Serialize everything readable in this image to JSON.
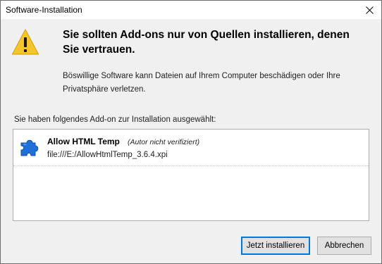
{
  "window": {
    "title": "Software-Installation",
    "close_icon": "close-icon"
  },
  "warning": {
    "icon": "warning-icon",
    "accent_color": "#f5c52b",
    "heading": "Sie sollten Add-ons nur von Quellen installieren, denen Sie vertrauen.",
    "description": "Böswillige Software kann Dateien auf Ihrem Computer beschädigen oder Ihre Privatsphäre verletzen."
  },
  "addon_list": {
    "label": "Sie haben folgendes Add-on zur Installation ausgewählt:",
    "items": [
      {
        "icon": "puzzle-piece-icon",
        "icon_color": "#1e6fd9",
        "name": "Allow HTML Temp",
        "author_note": "(Autor nicht verifiziert)",
        "url": "file:///E:/AllowHtmlTemp_3.6.4.xpi"
      }
    ]
  },
  "buttons": {
    "install_label": "Jetzt installieren",
    "cancel_label": "Abbrechen",
    "focus_color": "#0078d7"
  }
}
